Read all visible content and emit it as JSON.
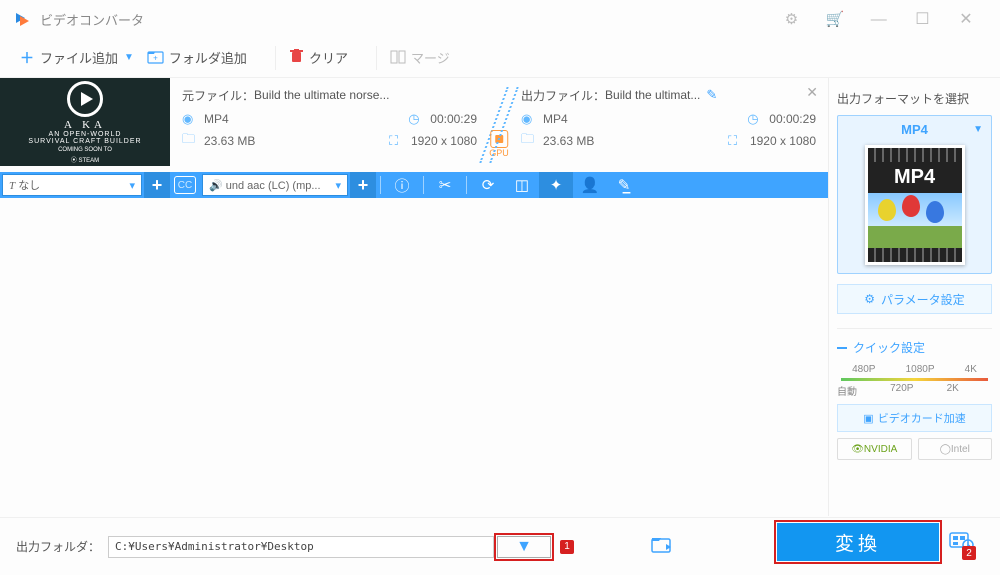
{
  "titlebar": {
    "title": "ビデオコンバータ"
  },
  "toolbar": {
    "add_file": "ファイル追加",
    "add_folder": "フォルダ追加",
    "clear": "クリア",
    "merge": "マージ"
  },
  "file": {
    "thumb": {
      "line1": "A   KA",
      "line2": "AN OPEN-WORLD",
      "line3": "SURVIVAL CRAFT BUILDER",
      "line4": "COMING SOON TO",
      "steam": "⦿ STEAM"
    },
    "source": {
      "label": "元ファイル：",
      "name": "Build the ultimate norse...",
      "format": "MP4",
      "duration": "00:00:29",
      "size": "23.63 MB",
      "resolution": "1920 x 1080"
    },
    "output": {
      "label": "出力ファイル：",
      "name": "Build the ultimat...",
      "format": "MP4",
      "duration": "00:00:29",
      "size": "23.63 MB",
      "resolution": "1920 x 1080"
    },
    "gpu_label": "GPU",
    "subtitle_select": {
      "icon": "T",
      "value": "なし"
    },
    "audio_select": {
      "value": "und aac (LC) (mp..."
    }
  },
  "right": {
    "title": "出力フォーマットを選択",
    "format": "MP4",
    "format_badge": "MP4",
    "param_btn": "パラメータ設定",
    "quick_title": "クイック設定",
    "scale_top": [
      "480P",
      "1080P",
      "4K"
    ],
    "scale_bot": [
      "自動",
      "720P",
      "2K",
      ""
    ],
    "gpu_btn": "ビデオカード加速",
    "nvidia": "NVIDIA",
    "intel": "Intel"
  },
  "bottom": {
    "label": "出力フォルダ：",
    "path": "C:¥Users¥Administrator¥Desktop",
    "convert": "変換",
    "marker1": "1",
    "marker2": "2"
  }
}
